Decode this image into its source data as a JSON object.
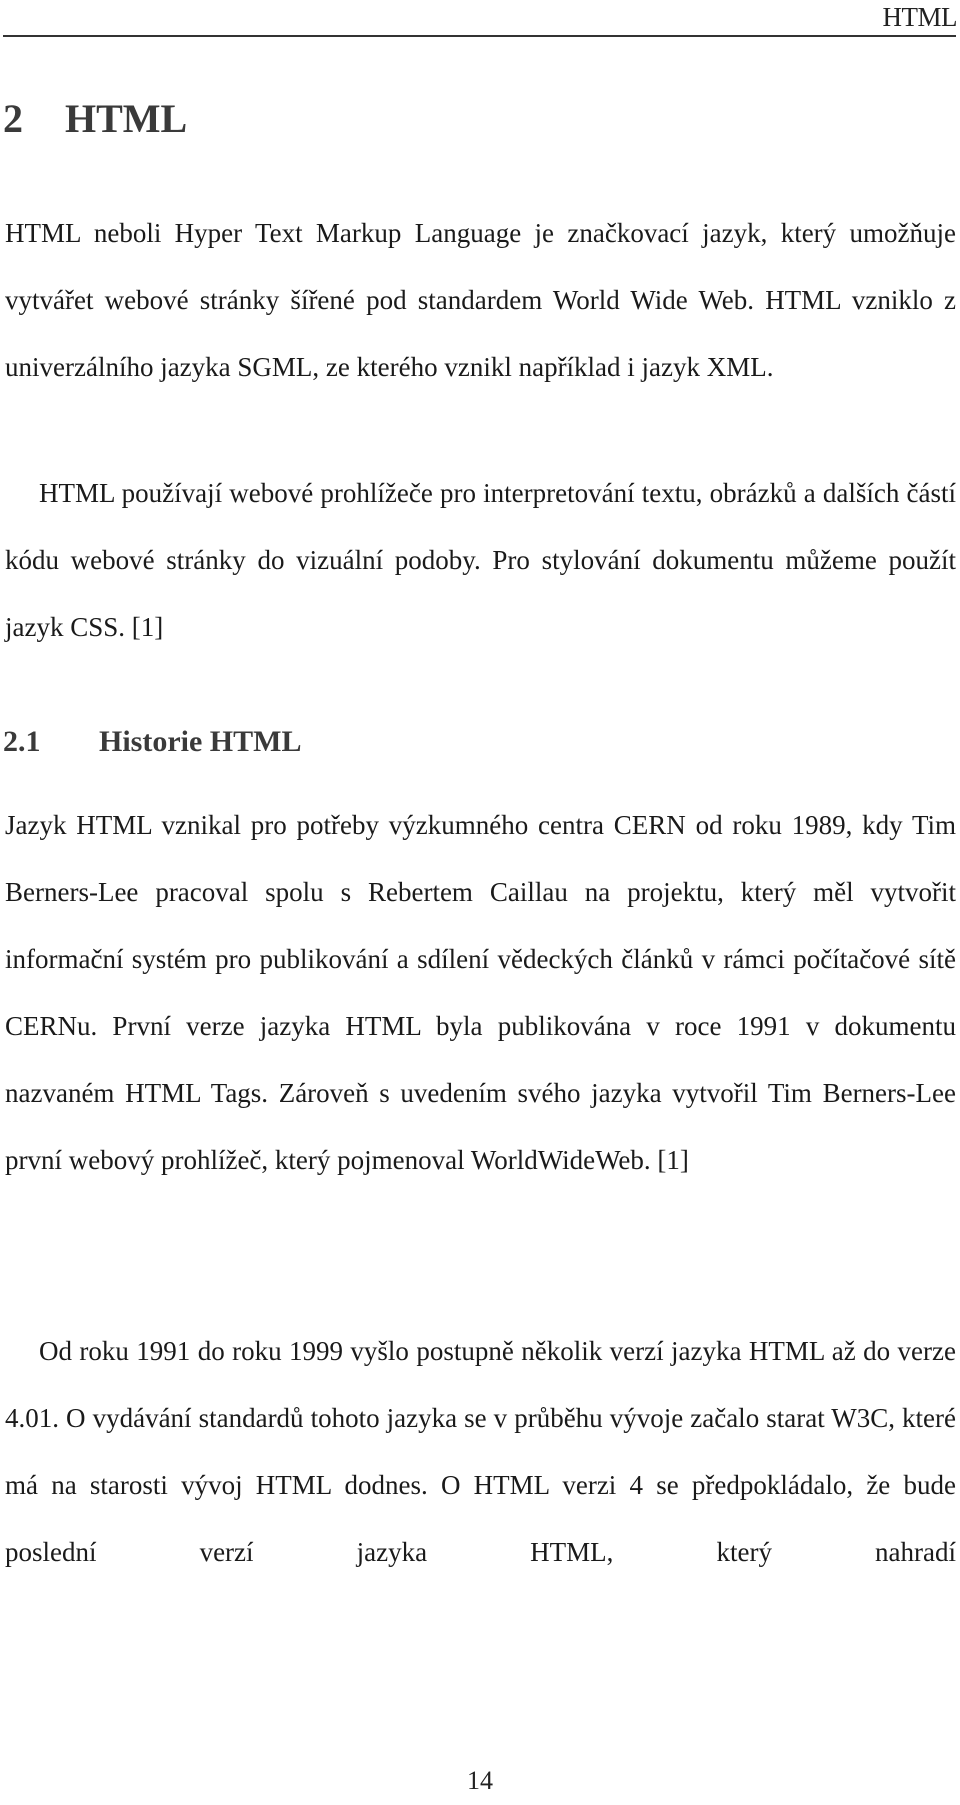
{
  "running_header": "HTML",
  "chapter": {
    "number": "2",
    "title": "HTML"
  },
  "paragraphs_intro": [
    "HTML neboli Hyper Text Markup Language je značkovací jazyk, který umožňuje vytvářet webové stránky šířené pod standardem World Wide Web. HTML vzniklo z univerzálního jazyka SGML, ze kterého vznikl například i jazyk XML.",
    "HTML používají webové prohlížeče pro interpretování textu, obrázků a dalších částí kódu webové stránky do vizuální podoby. Pro stylování dokumentu můžeme použít jazyk CSS. [1]"
  ],
  "section": {
    "number": "2.1",
    "title": "Historie HTML",
    "paragraphs": [
      "Jazyk HTML vznikal pro potřeby výzkumného centra CERN od roku 1989, kdy Tim Berners-Lee pracoval spolu s Rebertem Caillau na projektu, který měl vytvořit informační systém pro publikování a sdílení vědeckých článků v rámci počítačové sítě CERNu. První verze jazyka HTML byla publikována v roce 1991 v dokumentu nazvaném HTML Tags. Zároveň s uvedením svého jazyka vytvořil Tim Berners-Lee první webový prohlížeč, který pojmenoval WorldWideWeb. [1]",
      "Od roku 1991 do roku 1999 vyšlo postupně několik verzí jazyka HTML až do verze 4.01. O vydávání standardů tohoto jazyka se v průběhu vývoje začalo starat W3C, které má na starosti vývoj HTML dodnes. O HTML verzi 4 se předpokládalo, že bude poslední verzí jazyka HTML, který nahradí"
    ]
  },
  "page_number": "14"
}
